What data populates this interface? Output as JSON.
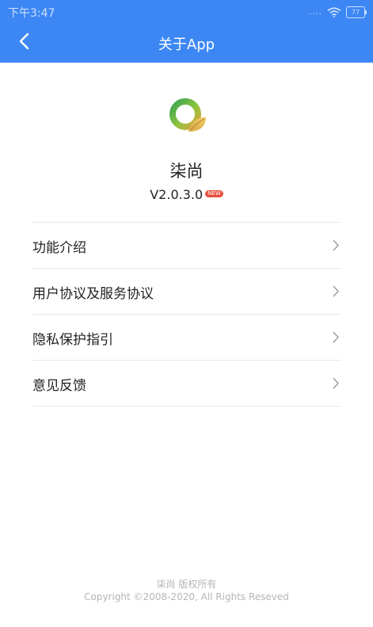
{
  "status_bar": {
    "time": "下午3:47",
    "signal": "....",
    "battery": "77"
  },
  "nav": {
    "title": "关于App",
    "back_icon": "chevron-left-icon"
  },
  "app": {
    "logo_icon": "app-logo-icon",
    "name": "柒尚",
    "version": "V2.0.3.0",
    "new_badge": "NEW"
  },
  "menu": {
    "items": [
      {
        "label": "功能介绍",
        "icon": "chevron-right-icon"
      },
      {
        "label": "用户协议及服务协议",
        "icon": "chevron-right-icon"
      },
      {
        "label": "隐私保护指引",
        "icon": "chevron-right-icon"
      },
      {
        "label": "意见反馈",
        "icon": "chevron-right-icon"
      }
    ]
  },
  "footer": {
    "owner": "柒尚 版权所有",
    "copyright": "Copyright ©2008-2020, All Rights Reseved"
  },
  "colors": {
    "header_bg": "#3d87f5",
    "badge_bg": "#e8503e",
    "divider": "#e8e8e8",
    "footer_text": "#b5b5b5"
  }
}
